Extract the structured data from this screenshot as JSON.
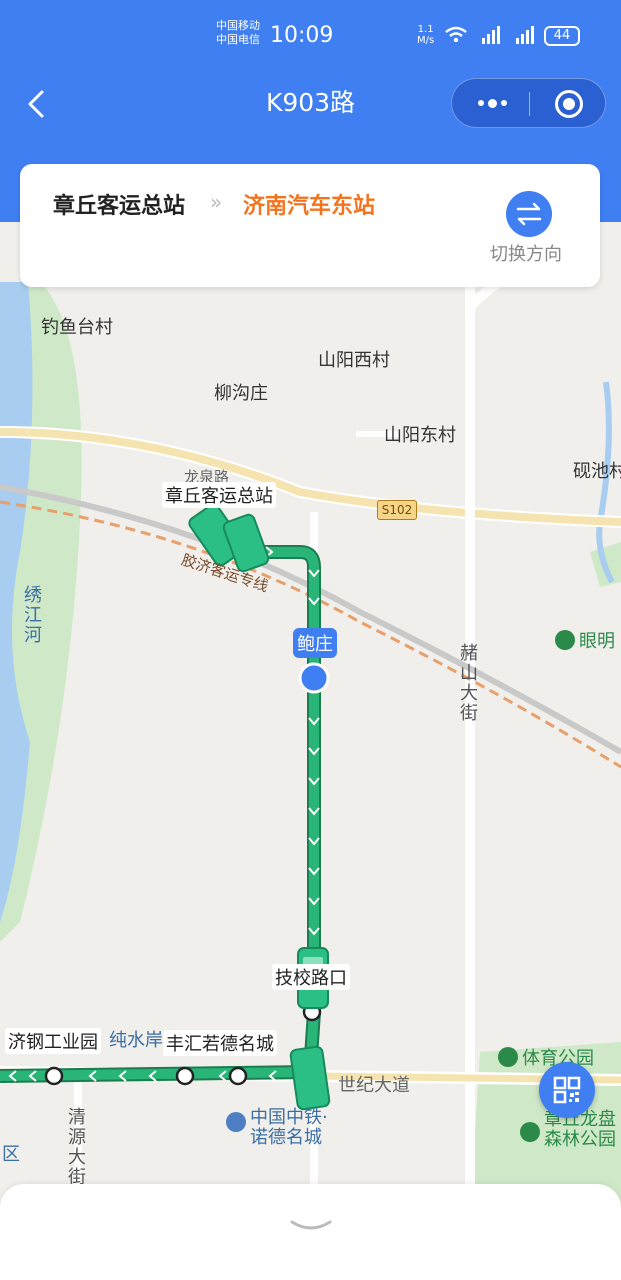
{
  "status_bar": {
    "carrier_1": "中国移动",
    "carrier_2": "中国电信",
    "time": "10:09",
    "net_speed_value": "1.1",
    "net_speed_unit": "M/s",
    "battery": "44"
  },
  "nav": {
    "title": "K903路"
  },
  "route": {
    "from": "章丘客运总站",
    "to": "济南汽车东站",
    "switch_label": "切换方向"
  },
  "map": {
    "labels": {
      "diaoyutai": "钓鱼台村",
      "shanyangxi": "山阳西村",
      "liugouzhuang": "柳沟庄",
      "shanyangdong": "山阳东村",
      "yanchi": "砚池村",
      "longquan": "龙泉路",
      "zhangqiu_station": "章丘客运总站",
      "railway": "胶济客运专线",
      "xiujiang": "绣江河",
      "baozhuang": "鲍庄",
      "yanming": "眼明",
      "xishan": "赭山大街",
      "jixiao": "技校路口",
      "jigang": "济钢工业园",
      "chunshui": "纯水岸",
      "fenghui": "丰汇若德名城",
      "tiyu": "体育公园",
      "shiji": "世纪大道",
      "zhongtie": "中国中铁·\n诺德名城",
      "longpan": "章丘龙盘\n森林公园",
      "qingyuan": "清源大街",
      "qu": "区",
      "s102": "S102"
    },
    "colors": {
      "route_green": "#1a9a63",
      "highlight_blue": "#3f7ff2",
      "river": "#a8cdf0",
      "green_area": "#c9e8c4"
    }
  }
}
